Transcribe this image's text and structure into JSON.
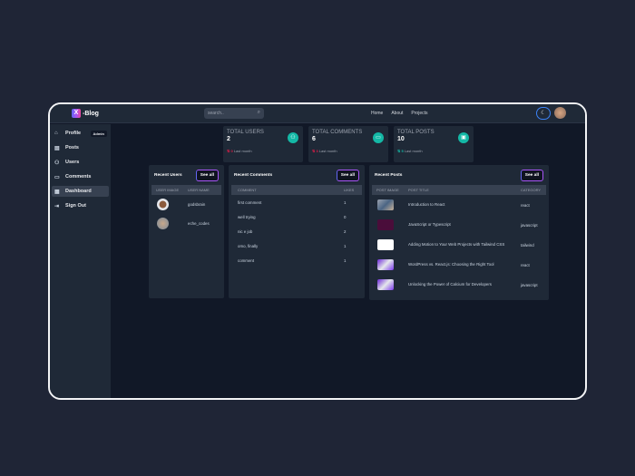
{
  "header": {
    "logo_letter": "X",
    "logo_text": "-Blog",
    "search_placeholder": "search..",
    "nav": [
      "Home",
      "About",
      "Projects"
    ]
  },
  "sidebar": {
    "items": [
      {
        "label": "Profile",
        "icon": "home-icon",
        "badge": "Admin"
      },
      {
        "label": "Posts",
        "icon": "posts-icon"
      },
      {
        "label": "Users",
        "icon": "users-icon"
      },
      {
        "label": "Comments",
        "icon": "comments-icon"
      },
      {
        "label": "Dashboard",
        "icon": "dashboard-icon",
        "active": true
      },
      {
        "label": "Sign Out",
        "icon": "signout-icon"
      }
    ]
  },
  "stats": [
    {
      "title": "TOTAL USERS",
      "value": "2",
      "delta": "0",
      "delta_label": "Last month",
      "icon": "users-icon"
    },
    {
      "title": "TOTAL COMMENTS",
      "value": "6",
      "delta": "3",
      "delta_label": "Last month",
      "icon": "comment-icon"
    },
    {
      "title": "TOTAL POSTS",
      "value": "10",
      "delta": "5",
      "delta_label": "Last month",
      "icon": "document-icon"
    }
  ],
  "recent_users": {
    "title": "Recent Users",
    "see_all": "See all",
    "columns": [
      "USER IMAGE",
      "USER NAME"
    ],
    "rows": [
      {
        "name": "godsbrain"
      },
      {
        "name": "eche_codes"
      }
    ]
  },
  "recent_comments": {
    "title": "Recent Comments",
    "see_all": "See all",
    "columns": [
      "COMMENT",
      "LIKES"
    ],
    "rows": [
      {
        "comment": "first comment",
        "likes": "1"
      },
      {
        "comment": "well trying",
        "likes": "0"
      },
      {
        "comment": "nic e job",
        "likes": "2"
      },
      {
        "comment": "omo, finally",
        "likes": "1"
      },
      {
        "comment": "comment",
        "likes": "1"
      }
    ]
  },
  "recent_posts": {
    "title": "Recent Posts",
    "see_all": "See all",
    "columns": [
      "POST IMAGE",
      "POST TITLE",
      "CATEGORY"
    ],
    "rows": [
      {
        "title": "Introduction to React",
        "category": "react"
      },
      {
        "title": "JavaScript or Typescript",
        "category": "javascript"
      },
      {
        "title": "Adding Motion to Your Web Projects with Tailwind CSS",
        "category": "tailwind"
      },
      {
        "title": "WordPress vs. React.js: Choosing the Right Tool",
        "category": "react"
      },
      {
        "title": "Unlocking the Power of Calcium for Developers",
        "category": "javascript"
      }
    ]
  }
}
